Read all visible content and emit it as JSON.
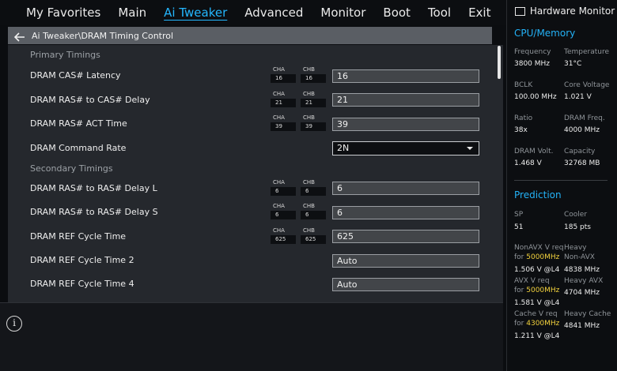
{
  "tabs": [
    "My Favorites",
    "Main",
    "Ai Tweaker",
    "Advanced",
    "Monitor",
    "Boot",
    "Tool",
    "Exit"
  ],
  "active_tab": "Ai Tweaker",
  "breadcrumb": "Ai Tweaker\\DRAM Timing Control",
  "sections": {
    "primary": "Primary Timings",
    "secondary": "Secondary Timings"
  },
  "rows": [
    {
      "label": "DRAM CAS# Latency",
      "cha_label": "CHA",
      "cha": "16",
      "chb_label": "CHB",
      "chb": "16",
      "value": "16"
    },
    {
      "label": "DRAM RAS# to CAS# Delay",
      "cha_label": "CHA",
      "cha": "21",
      "chb_label": "CHB",
      "chb": "21",
      "value": "21"
    },
    {
      "label": "DRAM RAS# ACT Time",
      "cha_label": "CHA",
      "cha": "39",
      "chb_label": "CHB",
      "chb": "39",
      "value": "39"
    },
    {
      "label": "DRAM Command Rate",
      "value": "2N"
    },
    {
      "label": "DRAM RAS# to RAS# Delay L",
      "cha_label": "CHA",
      "cha": "6",
      "chb_label": "CHB",
      "chb": "6",
      "value": "6"
    },
    {
      "label": "DRAM RAS# to RAS# Delay S",
      "cha_label": "CHA",
      "cha": "6",
      "chb_label": "CHB",
      "chb": "6",
      "value": "6"
    },
    {
      "label": "DRAM REF Cycle Time",
      "cha_label": "CHA",
      "cha": "625",
      "chb_label": "CHB",
      "chb": "625",
      "value": "625"
    },
    {
      "label": "DRAM REF Cycle Time 2",
      "value": "Auto"
    },
    {
      "label": "DRAM REF Cycle Time 4",
      "value": "Auto"
    }
  ],
  "hw": {
    "title": "Hardware Monitor",
    "cpu_mem_heading": "CPU/Memory",
    "prediction_heading": "Prediction",
    "cpu": [
      {
        "label": "Frequency",
        "value": "3800 MHz"
      },
      {
        "label": "Temperature",
        "value": "31°C"
      },
      {
        "label": "BCLK",
        "value": "100.00 MHz"
      },
      {
        "label": "Core Voltage",
        "value": "1.021 V"
      },
      {
        "label": "Ratio",
        "value": "38x"
      },
      {
        "label": "DRAM Freq.",
        "value": "4000 MHz"
      },
      {
        "label": "DRAM Volt.",
        "value": "1.468 V"
      },
      {
        "label": "Capacity",
        "value": "32768 MB"
      }
    ],
    "prediction": {
      "sp_label": "SP",
      "sp_value": "51",
      "cooler_label": "Cooler",
      "cooler_value": "185 pts",
      "nonavx_l1": "NonAVX V req",
      "nonavx_for": "for ",
      "nonavx_freq": "5000MHz",
      "nonavx_v": "1.506 V @L4",
      "nonavx_heavy_l1": "Heavy",
      "nonavx_heavy_l2": "Non-AVX",
      "nonavx_heavy_v": "4838 MHz",
      "avx_l1": "AVX V req",
      "avx_for": "for ",
      "avx_freq": "5000MHz",
      "avx_v": "1.581 V @L4",
      "avx_heavy_l1": "Heavy AVX",
      "avx_heavy_v": "4704 MHz",
      "cache_l1": "Cache V req",
      "cache_for": "for ",
      "cache_freq": "4300MHz",
      "cache_v": "1.211 V @L4",
      "cache_heavy_l1": "Heavy Cache",
      "cache_heavy_v": "4841 MHz"
    }
  },
  "colors": {
    "accent": "#24b7ff",
    "highlight": "#f3d23d"
  }
}
